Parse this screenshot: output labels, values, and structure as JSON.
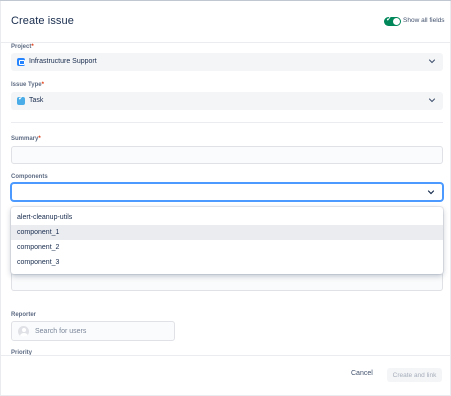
{
  "dialog": {
    "title": "Create issue",
    "show_all_fields_label": "Show all fields",
    "show_all_fields_on": true
  },
  "fields": {
    "project": {
      "label": "Project",
      "required_mark": "*",
      "value": "Infrastructure Support",
      "icon": "project-icon"
    },
    "issue_type": {
      "label": "Issue Type",
      "required_mark": "*",
      "value": "Task",
      "icon": "task-checkbox-icon"
    },
    "summary": {
      "label": "Summary",
      "required_mark": "*",
      "value": ""
    },
    "components": {
      "label": "Components",
      "value": "",
      "options": [
        "alert-cleanup-utils",
        "component_1",
        "component_2",
        "component_3"
      ],
      "highlighted_option": "component_1"
    },
    "reporter": {
      "label": "Reporter",
      "placeholder": "Search for users"
    },
    "priority": {
      "label": "Priority"
    }
  },
  "footer": {
    "cancel_label": "Cancel",
    "create_label": "Create and link"
  },
  "colors": {
    "accent": "#0052cc",
    "toggle_on": "#00875a",
    "required": "#de350b",
    "focus": "#4c9aff"
  }
}
